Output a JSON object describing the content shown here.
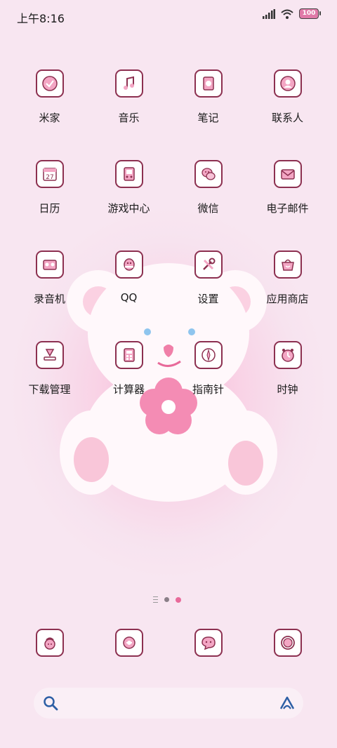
{
  "status_bar": {
    "time": "上午8:16",
    "battery": "100"
  },
  "apps": [
    [
      {
        "label": "米家",
        "icon": "mijia-icon"
      },
      {
        "label": "音乐",
        "icon": "music-icon"
      },
      {
        "label": "笔记",
        "icon": "notes-icon"
      },
      {
        "label": "联系人",
        "icon": "contacts-icon"
      }
    ],
    [
      {
        "label": "日历",
        "icon": "calendar-icon",
        "badge": "27"
      },
      {
        "label": "游戏中心",
        "icon": "game-center-icon"
      },
      {
        "label": "微信",
        "icon": "wechat-icon"
      },
      {
        "label": "电子邮件",
        "icon": "email-icon"
      }
    ],
    [
      {
        "label": "录音机",
        "icon": "recorder-icon"
      },
      {
        "label": "QQ",
        "icon": "qq-icon"
      },
      {
        "label": "设置",
        "icon": "settings-icon"
      },
      {
        "label": "应用商店",
        "icon": "app-store-icon"
      }
    ],
    [
      {
        "label": "下载管理",
        "icon": "download-manager-icon"
      },
      {
        "label": "计算器",
        "icon": "calculator-icon"
      },
      {
        "label": "指南针",
        "icon": "compass-icon"
      },
      {
        "label": "时钟",
        "icon": "clock-icon"
      }
    ]
  ],
  "dock": [
    "phone-icon",
    "messages-icon",
    "browser-icon",
    "camera-icon"
  ],
  "pager": {
    "current_page": 2,
    "pages": 2
  },
  "colors": {
    "icon_border": "#8c3050",
    "accent_pink": "#e86a9a",
    "search_blue": "#2d5fa5"
  }
}
